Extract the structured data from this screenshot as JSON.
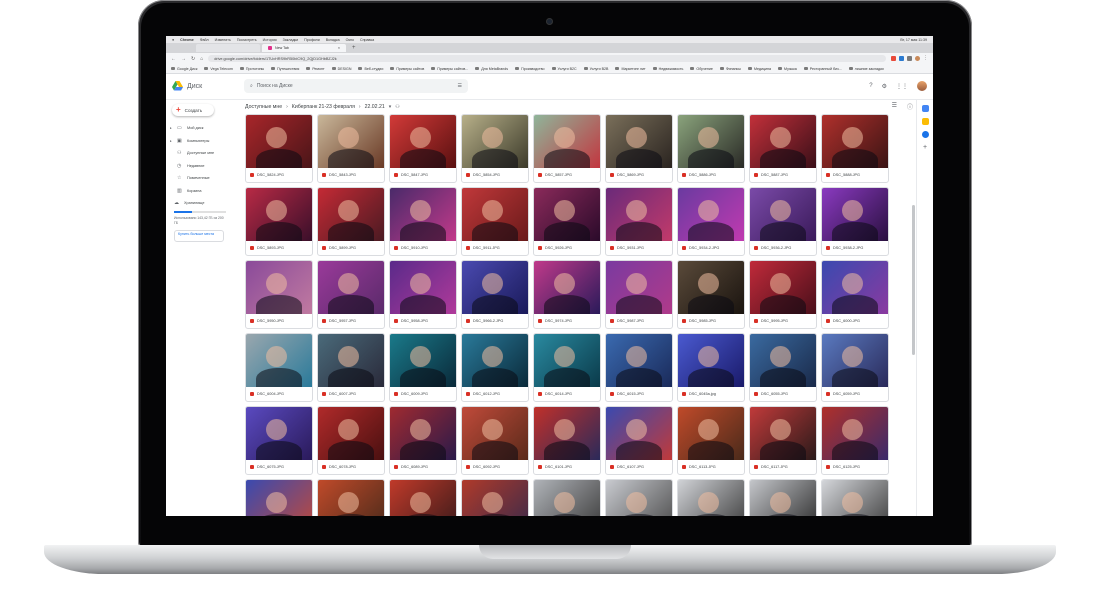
{
  "mac": {
    "app_name": "Chrome",
    "menu": [
      "Файл",
      "Изменить",
      "Посмотреть",
      "История",
      "Закладки",
      "Профили",
      "Вкладка",
      "Окно",
      "Справка"
    ],
    "clock": "Вт, 17 мая 11:39"
  },
  "browser": {
    "tab_title": "New Tab",
    "url": "drive.google.com/drive/folders/1TUvHRS9hR50bIC9Q_2QjD1GHbBZJ2k",
    "bookmarks": [
      "Google Диск",
      "Vega Telecom",
      "Прототипы",
      "Путешествия",
      "Ремонт",
      "DESIGN",
      "Веб-студии",
      "Примеры сайтов",
      "Примеры сайтов...",
      "Для MetaBrands",
      "Производство",
      "Услуги B2C",
      "Услуги B2B",
      "Маркетинг лит",
      "Недвижимость",
      "Обучение",
      "Финансы",
      "Медицина",
      "Музыка",
      "Ресторанный биз...",
      "лишние закладки"
    ]
  },
  "drive": {
    "logo_text": "Диск",
    "search_placeholder": "Поиск на Диске",
    "create_label": "Создать",
    "nav": [
      {
        "label": "Мой диск",
        "icon": "drive-icon"
      },
      {
        "label": "Компьютеры",
        "icon": "computer-icon"
      },
      {
        "label": "Доступные мне",
        "icon": "shared-icon"
      },
      {
        "label": "Недавние",
        "icon": "clock-icon"
      },
      {
        "label": "Помеченные",
        "icon": "star-icon"
      },
      {
        "label": "Корзина",
        "icon": "trash-icon"
      }
    ],
    "storage_label": "Хранилище",
    "storage_fraction": 0.35,
    "storage_text": "Использовано 143,42 ГБ из 200 ГБ",
    "buy_label": "Купить больше места",
    "breadcrumb": [
      "Доступные мне",
      "Киберпанк 21-23 февраля",
      "22.02.21"
    ]
  },
  "files": [
    {
      "name": "DSC_5824.JPG",
      "c1": "#a8262a",
      "c2": "#4a1518"
    },
    {
      "name": "DSC_5843.JPG",
      "c1": "#c9b79a",
      "c2": "#6a3a26"
    },
    {
      "name": "DSC_5847.JPG",
      "c1": "#d23a38",
      "c2": "#5a1010"
    },
    {
      "name": "DSC_5854.JPG",
      "c1": "#b7b089",
      "c2": "#3c3a2a"
    },
    {
      "name": "DSC_5857.JPG",
      "c1": "#8fb59a",
      "c2": "#c2363f"
    },
    {
      "name": "DSC_5869.JPG",
      "c1": "#7a6f5a",
      "c2": "#2a2420"
    },
    {
      "name": "DSC_5886.JPG",
      "c1": "#8aa37c",
      "c2": "#2a2a26"
    },
    {
      "name": "DSC_5887.JPG",
      "c1": "#c2303a",
      "c2": "#3a0f18"
    },
    {
      "name": "DSC_5888.JPG",
      "c1": "#b0302c",
      "c2": "#3a1414"
    },
    {
      "name": "DSC_5893.JPG",
      "c1": "#b82a45",
      "c2": "#3a0f2a"
    },
    {
      "name": "DSC_5899.JPG",
      "c1": "#c42a35",
      "c2": "#4a1a22"
    },
    {
      "name": "DSC_5910.JPG",
      "c1": "#4a2a6a",
      "c2": "#c23a8a"
    },
    {
      "name": "DSC_5911.JPG",
      "c1": "#c0383a",
      "c2": "#6a1a1a"
    },
    {
      "name": "DSC_5926.JPG",
      "c1": "#8a2a5a",
      "c2": "#2a0a2a"
    },
    {
      "name": "DSC_5931.JPG",
      "c1": "#6a2a7a",
      "c2": "#c23a6a"
    },
    {
      "name": "DSC_5934-2.JPG",
      "c1": "#6a3aa0",
      "c2": "#c03ab0"
    },
    {
      "name": "DSC_5936-2.JPG",
      "c1": "#7a4aa8",
      "c2": "#3a1a5a"
    },
    {
      "name": "DSC_5938-2.JPG",
      "c1": "#8a3ac0",
      "c2": "#2a1040"
    },
    {
      "name": "DSC_5950.JPG",
      "c1": "#8a4a9a",
      "c2": "#c07aa0"
    },
    {
      "name": "DSC_5957.JPG",
      "c1": "#9a3a9a",
      "c2": "#5a2a6a"
    },
    {
      "name": "DSC_5958.JPG",
      "c1": "#5a2a8a",
      "c2": "#b03a9a"
    },
    {
      "name": "DSC_5966-2.JPG",
      "c1": "#4a4ab0",
      "c2": "#1a1a5a"
    },
    {
      "name": "DSC_5974.JPG",
      "c1": "#c03a8a",
      "c2": "#2a1a5a"
    },
    {
      "name": "DSC_5987.JPG",
      "c1": "#7a3aa0",
      "c2": "#b03a8a"
    },
    {
      "name": "DSC_5985.JPG",
      "c1": "#5a4a3a",
      "c2": "#1a140f"
    },
    {
      "name": "DSC_5995.JPG",
      "c1": "#c02a3a",
      "c2": "#4a0f1a"
    },
    {
      "name": "DSC_6000.JPG",
      "c1": "#3a4ab0",
      "c2": "#8a3aa0"
    },
    {
      "name": "DSC_6004.JPG",
      "c1": "#9aa7ae",
      "c2": "#2a7a9a"
    },
    {
      "name": "DSC_6007.JPG",
      "c1": "#4a6a7a",
      "c2": "#2a2a3a"
    },
    {
      "name": "DSC_6009.JPG",
      "c1": "#1a7a8a",
      "c2": "#0a2a3a"
    },
    {
      "name": "DSC_6012.JPG",
      "c1": "#2a7a9a",
      "c2": "#0a2a3a"
    },
    {
      "name": "DSC_6014.JPG",
      "c1": "#2a8aa0",
      "c2": "#0a3a4a"
    },
    {
      "name": "DSC_6015.JPG",
      "c1": "#3a6ab0",
      "c2": "#1a2a5a"
    },
    {
      "name": "DSC_6045a.jpg",
      "c1": "#4a5ad0",
      "c2": "#1a1a6a"
    },
    {
      "name": "DSC_6055.JPG",
      "c1": "#3a6aa0",
      "c2": "#1a2a4a"
    },
    {
      "name": "DSC_6059.JPG",
      "c1": "#5a7ac0",
      "c2": "#2a2a5a"
    },
    {
      "name": "DSC_6075.JPG",
      "c1": "#5a4ac0",
      "c2": "#2a1a5a"
    },
    {
      "name": "DSC_6078.JPG",
      "c1": "#b02a2a",
      "c2": "#4a1010"
    },
    {
      "name": "DSC_6089.JPG",
      "c1": "#a02a30",
      "c2": "#2a1a4a"
    },
    {
      "name": "DSC_6092.JPG",
      "c1": "#c04a3a",
      "c2": "#5a2a1a"
    },
    {
      "name": "DSC_6101.JPG",
      "c1": "#c0302a",
      "c2": "#2a2a5a"
    },
    {
      "name": "DSC_6107.JPG",
      "c1": "#3a4ab0",
      "c2": "#c03a3a"
    },
    {
      "name": "DSC_6113.JPG",
      "c1": "#c04a2a",
      "c2": "#4a2a1a"
    },
    {
      "name": "DSC_6117.JPG",
      "c1": "#c03a3a",
      "c2": "#2a1a1a"
    },
    {
      "name": "DSC_6125.JPG",
      "c1": "#b0302a",
      "c2": "#3a2a6a"
    },
    {
      "name": "DSC_6131.JPG",
      "c1": "#3a4ab0",
      "c2": "#c04a3a"
    },
    {
      "name": "DSC_6134.JPG",
      "c1": "#c04a2a",
      "c2": "#4a2a1a"
    },
    {
      "name": "DSC_6140.JPG",
      "c1": "#c03a2a",
      "c2": "#3a1a1a"
    },
    {
      "name": "DSC_6146.JPG",
      "c1": "#b03a2a",
      "c2": "#3a2a4a"
    },
    {
      "name": "DSC_6152.JPG",
      "c1": "#b0b3b8",
      "c2": "#3a3a3a"
    },
    {
      "name": "DSC_6158.JPG",
      "c1": "#c8cacf",
      "c2": "#4a4a4a"
    },
    {
      "name": "DSC_6161.JPG",
      "c1": "#d0d2d6",
      "c2": "#3a3a3a"
    },
    {
      "name": "DSC_6165.JPG",
      "c1": "#c4c6ca",
      "c2": "#2a2a2a"
    },
    {
      "name": "DSC_6170.JPG",
      "c1": "#d4d6da",
      "c2": "#3a3a3a"
    }
  ]
}
